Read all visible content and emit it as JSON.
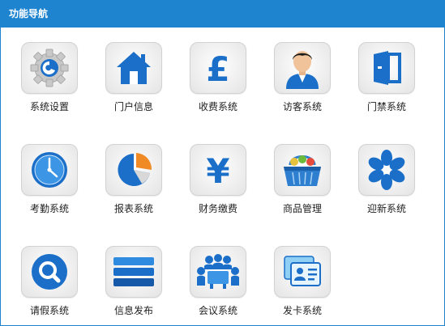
{
  "header": {
    "title": "功能导航"
  },
  "nav": {
    "items": [
      {
        "label": "系统设置",
        "icon": "gear-icon"
      },
      {
        "label": "门户信息",
        "icon": "home-icon"
      },
      {
        "label": "收费系统",
        "icon": "pound-icon"
      },
      {
        "label": "访客系统",
        "icon": "visitor-person-icon"
      },
      {
        "label": "门禁系统",
        "icon": "door-icon"
      },
      {
        "label": "考勤系统",
        "icon": "clock-icon"
      },
      {
        "label": "报表系统",
        "icon": "pie-chart-icon"
      },
      {
        "label": "财务缴费",
        "icon": "yen-icon"
      },
      {
        "label": "商品管理",
        "icon": "shopping-basket-icon"
      },
      {
        "label": "迎新系统",
        "icon": "flower-icon"
      },
      {
        "label": "请假系统",
        "icon": "search-icon"
      },
      {
        "label": "信息发布",
        "icon": "stacked-bars-icon"
      },
      {
        "label": "会议系统",
        "icon": "meeting-icon"
      },
      {
        "label": "发卡系统",
        "icon": "id-card-icon"
      }
    ]
  },
  "colors": {
    "header_bg": "#1e84d0",
    "icon_blue": "#1b6fc9",
    "border": "#1e84d0"
  }
}
